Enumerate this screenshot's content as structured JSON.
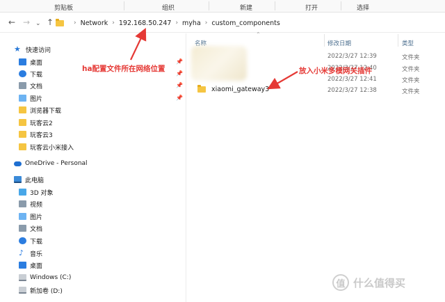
{
  "ribbon": {
    "clipboard": "剪贴板",
    "organize": "组织",
    "new": "新建",
    "open": "打开",
    "select": "选择"
  },
  "nav": {
    "back": "←",
    "forward": "→",
    "recent": "⌄",
    "up": "↑"
  },
  "breadcrumb": [
    "Network",
    "192.168.50.247",
    "myha",
    "custom_components"
  ],
  "columns": {
    "name": "名称",
    "date": "修改日期",
    "type": "类型"
  },
  "files": [
    {
      "date": "2022/3/27 12:39",
      "type": "文件夹"
    },
    {
      "date": "2022/3/27 12:40",
      "type": "文件夹"
    },
    {
      "date": "2022/3/27 12:41",
      "type": "文件夹"
    },
    {
      "name": "xiaomi_gateway3",
      "date": "2022/3/27 12:38",
      "type": "文件夹"
    }
  ],
  "sidebar": {
    "quick_access": "快速访问",
    "quick_items": [
      "桌面",
      "下载",
      "文档",
      "图片",
      "浏览器下载",
      "玩客云2",
      "玩客云3",
      "玩客云小米接入"
    ],
    "onedrive": "OneDrive - Personal",
    "this_pc": "此电脑",
    "pc_items": [
      "3D 对象",
      "视频",
      "图片",
      "文档",
      "下载",
      "音乐",
      "桌面",
      "Windows (C:)",
      "新加卷 (D:)"
    ]
  },
  "annotations": {
    "left": "ha配置文件所在网络位置",
    "right": "放入小米多模网关插件"
  },
  "watermark": {
    "logo": "值",
    "text": "什么值得买"
  },
  "colors": {
    "annotation": "#e53935",
    "folder": "#f5c542",
    "accent": "#2b7de0"
  }
}
